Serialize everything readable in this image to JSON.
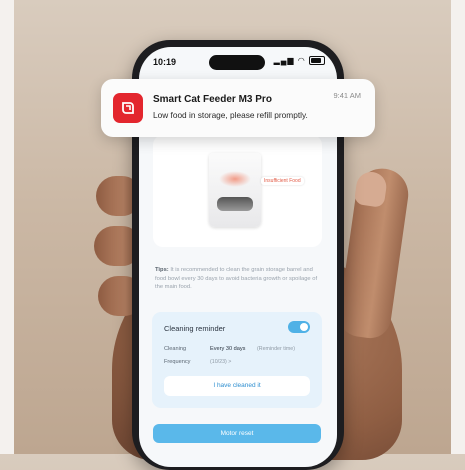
{
  "status_bar": {
    "time": "10:19",
    "icons": [
      "location-arrow-icon",
      "cellular-icon",
      "wifi-icon",
      "battery-icon"
    ]
  },
  "notification": {
    "app_title": "Smart Cat Feeder M3 Pro",
    "message": "Low food in storage, please refill promptly.",
    "time": "9:41 AM",
    "icon_color": "#e3262e"
  },
  "device_card": {
    "badge": "Insufficient Food"
  },
  "tips": {
    "label": "Tips:",
    "text": "It is recommended to clean the grain storage barrel and food bowl every 30 days to avoid bacteria growth or spoilage of the main food."
  },
  "cleaning": {
    "title": "Cleaning reminder",
    "enabled": true,
    "row1_label": "Cleaning",
    "row1_value": "Every 30 days",
    "row1_note": "(Reminder time)",
    "row2_label": "Frequency",
    "row2_value": "(10/23) >",
    "cleaned_button": "I have cleaned it"
  },
  "motor_reset_button": "Motor reset",
  "colors": {
    "accent": "#5ab8ea",
    "panel": "#e6f2fb",
    "alert": "#e25a45"
  }
}
